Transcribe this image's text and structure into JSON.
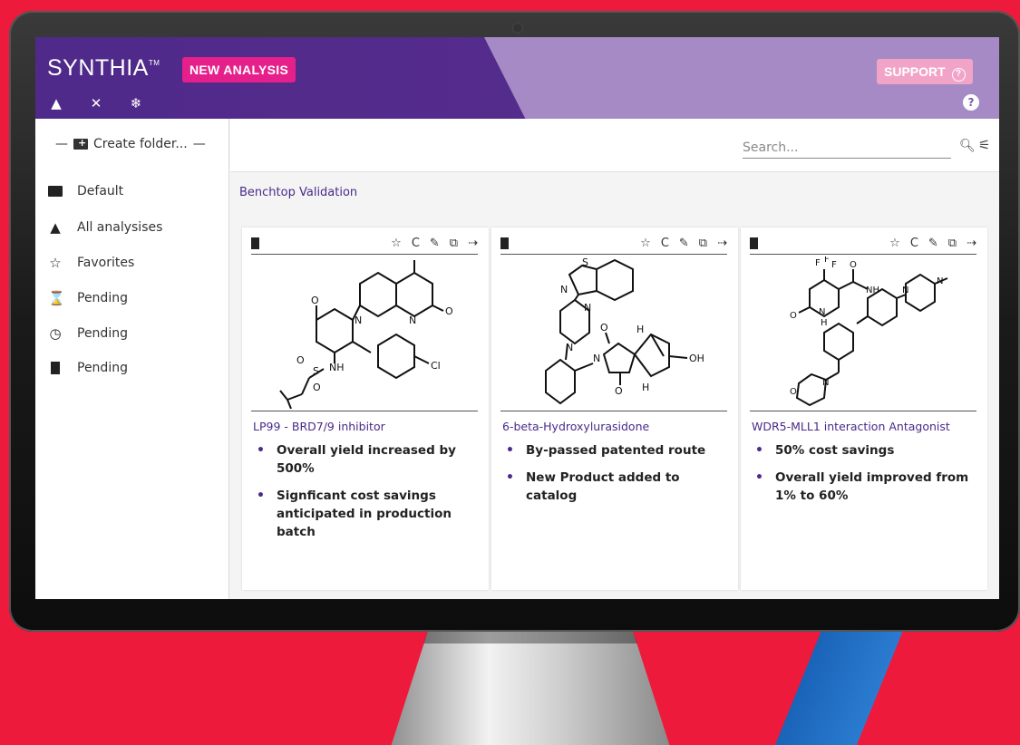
{
  "brand": {
    "name": "SYNTHIA",
    "tm": "TM"
  },
  "header": {
    "new_analysis_label": "NEW ANALYSIS",
    "support_label": "SUPPORT",
    "support_icon": "?",
    "help_icon": "?",
    "icons": {
      "home": "▲",
      "bell_off": "✕",
      "snowflake": "❄"
    }
  },
  "sidebar": {
    "create_folder_label": "Create folder...",
    "items": [
      {
        "label": "Default",
        "icon": "folder-icon",
        "glyph": "▬"
      },
      {
        "label": "All analysises",
        "icon": "home-icon",
        "glyph": "▲"
      },
      {
        "label": "Favorites",
        "icon": "star-icon",
        "glyph": "☆"
      },
      {
        "label": "Pending",
        "icon": "hourglass-icon",
        "glyph": "⌛"
      },
      {
        "label": "Pending",
        "icon": "clock-icon",
        "glyph": "◷"
      },
      {
        "label": "Pending",
        "icon": "trash-icon",
        "glyph": "▮"
      }
    ]
  },
  "search": {
    "placeholder": "Search..."
  },
  "breadcrumb": "Benchtop Validation",
  "cards": [
    {
      "title": "LP99 - BRD7/9 inhibitor",
      "bullets": [
        "Overall yield increased by 500%",
        "Signficant cost savings anticipated in production batch"
      ],
      "atoms": {
        "o1": "O",
        "n1": "N",
        "n2": "N",
        "o2": "O",
        "s": "S",
        "o3": "O",
        "o4": "O",
        "nh": "NH",
        "cl": "Cl"
      }
    },
    {
      "title": "6-beta-Hydroxylurasidone",
      "bullets": [
        "By-passed patented route",
        "New Product added to catalog"
      ],
      "atoms": {
        "s": "S",
        "n1": "N",
        "n2": "N",
        "n3": "N",
        "n4": "N",
        "o1": "O",
        "o2": "O",
        "h1": "H",
        "h2": "H",
        "oh": "OH"
      }
    },
    {
      "title": "WDR5-MLL1 interaction Antagonist",
      "bullets": [
        "50% cost savings",
        "Overall yield improved from 1% to 60%"
      ],
      "atoms": {
        "f1": "F",
        "f2": "F",
        "f3": "F",
        "o1": "O",
        "nh": "NH",
        "n1": "N",
        "n2": "N",
        "o2": "O",
        "n3": "N",
        "h": "H",
        "n4": "N",
        "o3": "O"
      }
    }
  ],
  "colors": {
    "brand_purple": "#5a2d8e",
    "accent_pink": "#e6208a",
    "background_red": "#ee1a3c"
  }
}
